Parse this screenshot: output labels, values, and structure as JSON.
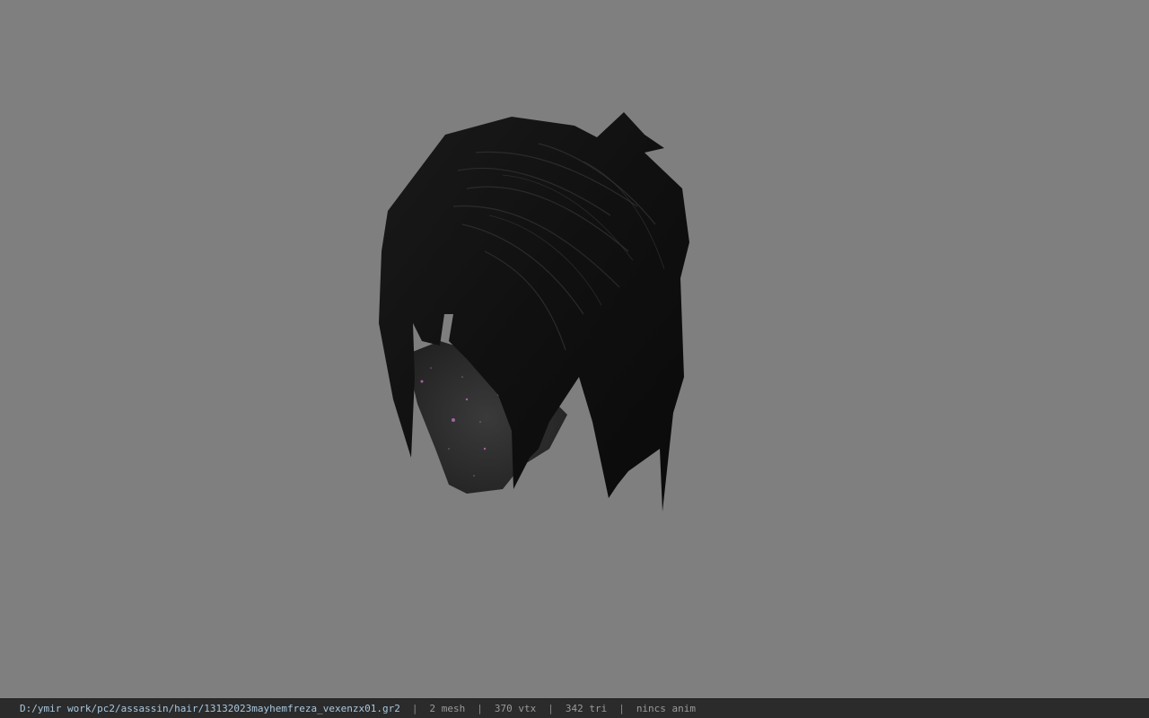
{
  "viewport": {
    "background": "#7f7f7f",
    "model_name": "hair model"
  },
  "status_bar": {
    "file_path": "D:/ymir work/pc2/assassin/hair/13132023mayhemfreza_vexenzx01.gr2",
    "separator": "|",
    "mesh_count": "2 mesh",
    "vertex_count": "370 vtx",
    "triangle_count": "342 tri",
    "animation": "nincs anim"
  }
}
